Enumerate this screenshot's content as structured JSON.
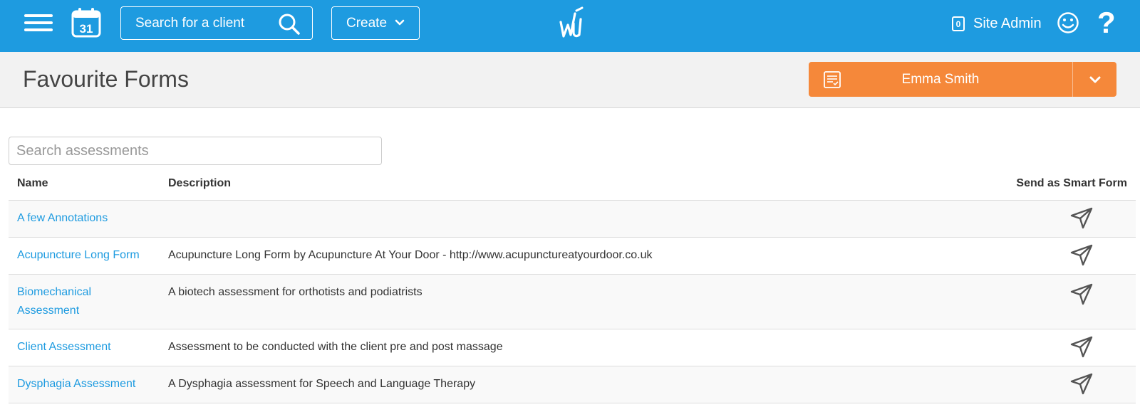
{
  "topbar": {
    "search_placeholder": "Search for a client",
    "create_label": "Create",
    "notification_count": "0",
    "user_label": "Site Admin",
    "help_label": "?",
    "calendar_day": "31",
    "icons": [
      "menu-icon",
      "calendar-icon",
      "search-icon",
      "chevron-down-icon",
      "logo-icon",
      "smile-icon",
      "help-icon"
    ]
  },
  "header": {
    "title": "Favourite Forms",
    "client_name": "Emma Smith"
  },
  "content": {
    "search_placeholder": "Search assessments",
    "columns": {
      "name": "Name",
      "description": "Description",
      "send": "Send as Smart Form"
    },
    "rows": [
      {
        "name": "A few Annotations",
        "description": ""
      },
      {
        "name": "Acupuncture Long Form",
        "description": "Acupuncture Long Form by Acupuncture At Your Door - http://www.acupunctureatyourdoor.co.uk"
      },
      {
        "name": "Biomechanical Assessment",
        "description": "A biotech assessment for orthotists and podiatrists"
      },
      {
        "name": "Client Assessment",
        "description": "Assessment to be conducted with the client pre and post massage"
      },
      {
        "name": "Dysphagia Assessment",
        "description": "A Dysphagia assessment for Speech and Language Therapy"
      }
    ]
  },
  "colors": {
    "topbar": "#1e9be0",
    "client_button": "#f5883a",
    "link": "#1e9be0"
  }
}
